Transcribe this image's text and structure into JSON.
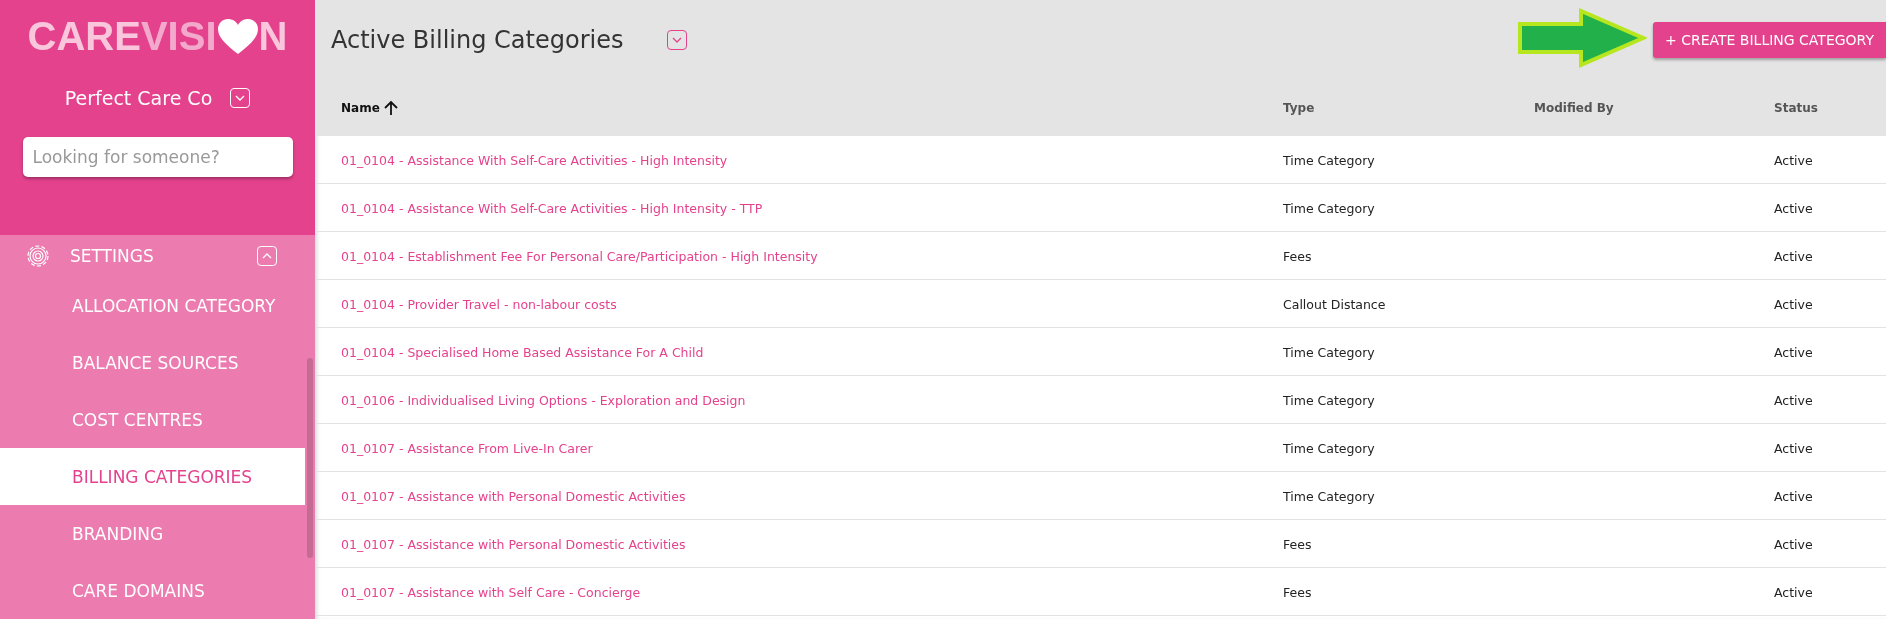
{
  "logo": {
    "parts": [
      "CARE",
      "VISI",
      "N"
    ]
  },
  "organisation": {
    "name": "Perfect Care Co"
  },
  "search": {
    "placeholder": "Looking for someone?"
  },
  "menu": {
    "section": {
      "label": "SETTINGS",
      "expanded": true
    },
    "items": [
      {
        "label": "ALLOCATION CATEGORY",
        "selected": false
      },
      {
        "label": "BALANCE SOURCES",
        "selected": false
      },
      {
        "label": "COST CENTRES",
        "selected": false
      },
      {
        "label": "BILLING CATEGORIES",
        "selected": true
      },
      {
        "label": "BRANDING",
        "selected": false
      },
      {
        "label": "CARE DOMAINS",
        "selected": false
      }
    ]
  },
  "page": {
    "title": "Active Billing Categories",
    "create_button": "+ CREATE BILLING CATEGORY"
  },
  "table": {
    "columns": [
      {
        "label": "Name",
        "sorted": true
      },
      {
        "label": "Type",
        "sorted": false
      },
      {
        "label": "Modified By",
        "sorted": false
      },
      {
        "label": "Status",
        "sorted": false
      }
    ],
    "rows": [
      {
        "name": "01_0104 - Assistance With Self-Care Activities - High Intensity",
        "type": "Time Category",
        "status": "Active"
      },
      {
        "name": "01_0104 - Assistance With Self-Care Activities - High Intensity - TTP",
        "type": "Time Category",
        "status": "Active"
      },
      {
        "name": "01_0104 - Establishment Fee For Personal Care/Participation - High Intensity",
        "type": "Fees",
        "status": "Active"
      },
      {
        "name": "01_0104 - Provider Travel - non-labour costs",
        "type": "Callout Distance",
        "status": "Active"
      },
      {
        "name": "01_0104 - Specialised Home Based Assistance For A Child",
        "type": "Time Category",
        "status": "Active"
      },
      {
        "name": "01_0106 - Individualised Living Options - Exploration and Design",
        "type": "Time Category",
        "status": "Active"
      },
      {
        "name": "01_0107 - Assistance From Live-In Carer",
        "type": "Time Category",
        "status": "Active"
      },
      {
        "name": "01_0107 - Assistance with Personal Domestic Activities",
        "type": "Time Category",
        "status": "Active"
      },
      {
        "name": "01_0107 - Assistance with Personal Domestic Activities",
        "type": "Fees",
        "status": "Active"
      },
      {
        "name": "01_0107 - Assistance with Self Care - Concierge",
        "type": "Fees",
        "status": "Active"
      }
    ]
  }
}
